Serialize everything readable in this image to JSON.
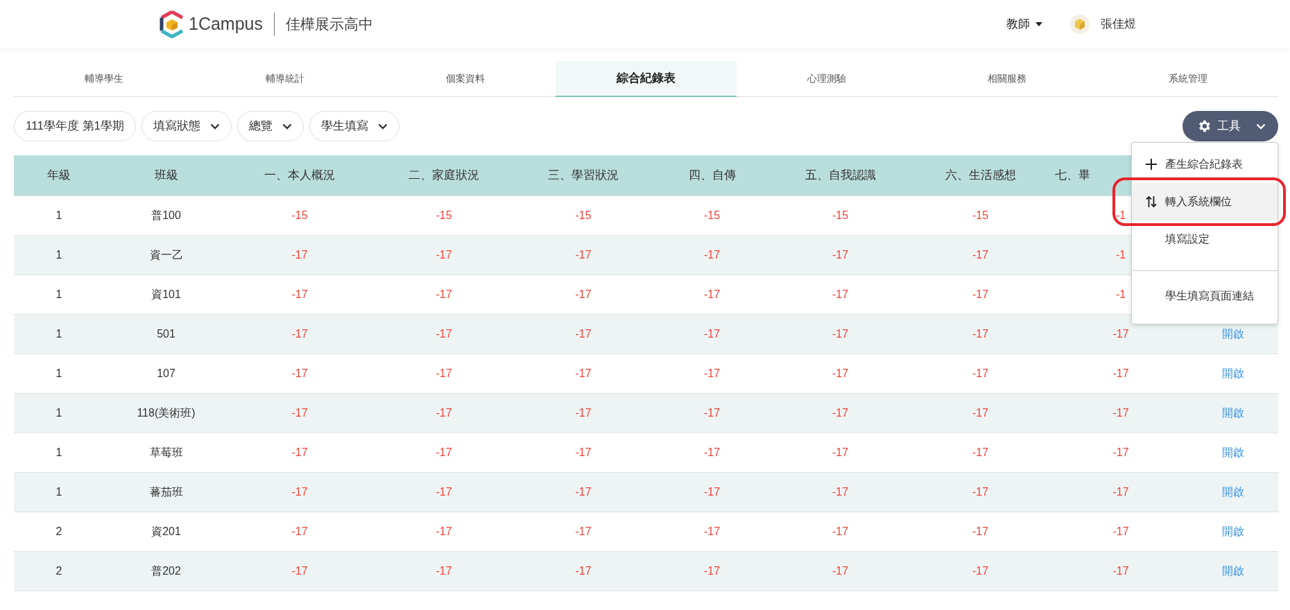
{
  "header": {
    "logo_text": "1Campus",
    "school": "佳樺展示高中",
    "role": "教師",
    "user": "張佳煜"
  },
  "tabs": [
    {
      "label": "輔導學生",
      "selected": false
    },
    {
      "label": "輔導統計",
      "selected": false
    },
    {
      "label": "個案資料",
      "selected": false
    },
    {
      "label": "綜合紀錄表",
      "selected": true
    },
    {
      "label": "心理測驗",
      "selected": false
    },
    {
      "label": "相關服務",
      "selected": false
    },
    {
      "label": "系統管理",
      "selected": false
    }
  ],
  "filters": [
    {
      "label": "111學年度 第1學期",
      "kind": "plain"
    },
    {
      "label": "填寫狀態",
      "kind": "dropdown"
    },
    {
      "label": "總覽",
      "kind": "dropdown"
    },
    {
      "label": "學生填寫",
      "kind": "dropdown"
    }
  ],
  "tools_button": {
    "label": "工具"
  },
  "tools_menu": {
    "items": [
      {
        "label": "產生綜合紀錄表",
        "kind": "add",
        "highlighted": false,
        "circled": false,
        "divider_before": false
      },
      {
        "label": "轉入系統欄位",
        "kind": "transfer",
        "highlighted": true,
        "circled": true,
        "divider_before": false
      },
      {
        "label": "填寫設定",
        "kind": "plain",
        "highlighted": false,
        "circled": false,
        "divider_before": false
      },
      {
        "label": "學生填寫頁面連結",
        "kind": "plain",
        "highlighted": false,
        "circled": false,
        "divider_before": true
      }
    ]
  },
  "table": {
    "columns": [
      "年級",
      "班級",
      "一、本人概況",
      "二、家庭狀況",
      "三、學習狀況",
      "四、自傳",
      "五、自我認識",
      "六、生活感想",
      "七、畢"
    ],
    "rows": [
      {
        "grade": "1",
        "class": "普100",
        "scores": [
          "-15",
          "-15",
          "-15",
          "-15",
          "-15",
          "-15",
          "-1"
        ]
      },
      {
        "grade": "1",
        "class": "資一乙",
        "scores": [
          "-17",
          "-17",
          "-17",
          "-17",
          "-17",
          "-17",
          "-1"
        ]
      },
      {
        "grade": "1",
        "class": "資101",
        "scores": [
          "-17",
          "-17",
          "-17",
          "-17",
          "-17",
          "-17",
          "-1"
        ]
      },
      {
        "grade": "1",
        "class": "501",
        "scores": [
          "-17",
          "-17",
          "-17",
          "-17",
          "-17",
          "-17",
          "-17"
        ],
        "link": "開啟"
      },
      {
        "grade": "1",
        "class": "107",
        "scores": [
          "-17",
          "-17",
          "-17",
          "-17",
          "-17",
          "-17",
          "-17"
        ],
        "link": "開啟"
      },
      {
        "grade": "1",
        "class": "118(美術班)",
        "scores": [
          "-17",
          "-17",
          "-17",
          "-17",
          "-17",
          "-17",
          "-17"
        ],
        "link": "開啟"
      },
      {
        "grade": "1",
        "class": "草莓班",
        "scores": [
          "-17",
          "-17",
          "-17",
          "-17",
          "-17",
          "-17",
          "-17"
        ],
        "link": "開啟"
      },
      {
        "grade": "1",
        "class": "蕃茄班",
        "scores": [
          "-17",
          "-17",
          "-17",
          "-17",
          "-17",
          "-17",
          "-17"
        ],
        "link": "開啟"
      },
      {
        "grade": "2",
        "class": "資201",
        "scores": [
          "-17",
          "-17",
          "-17",
          "-17",
          "-17",
          "-17",
          "-17"
        ],
        "link": "開啟"
      },
      {
        "grade": "2",
        "class": "普202",
        "scores": [
          "-17",
          "-17",
          "-17",
          "-17",
          "-17",
          "-17",
          "-17"
        ],
        "link": "開啟"
      }
    ]
  }
}
